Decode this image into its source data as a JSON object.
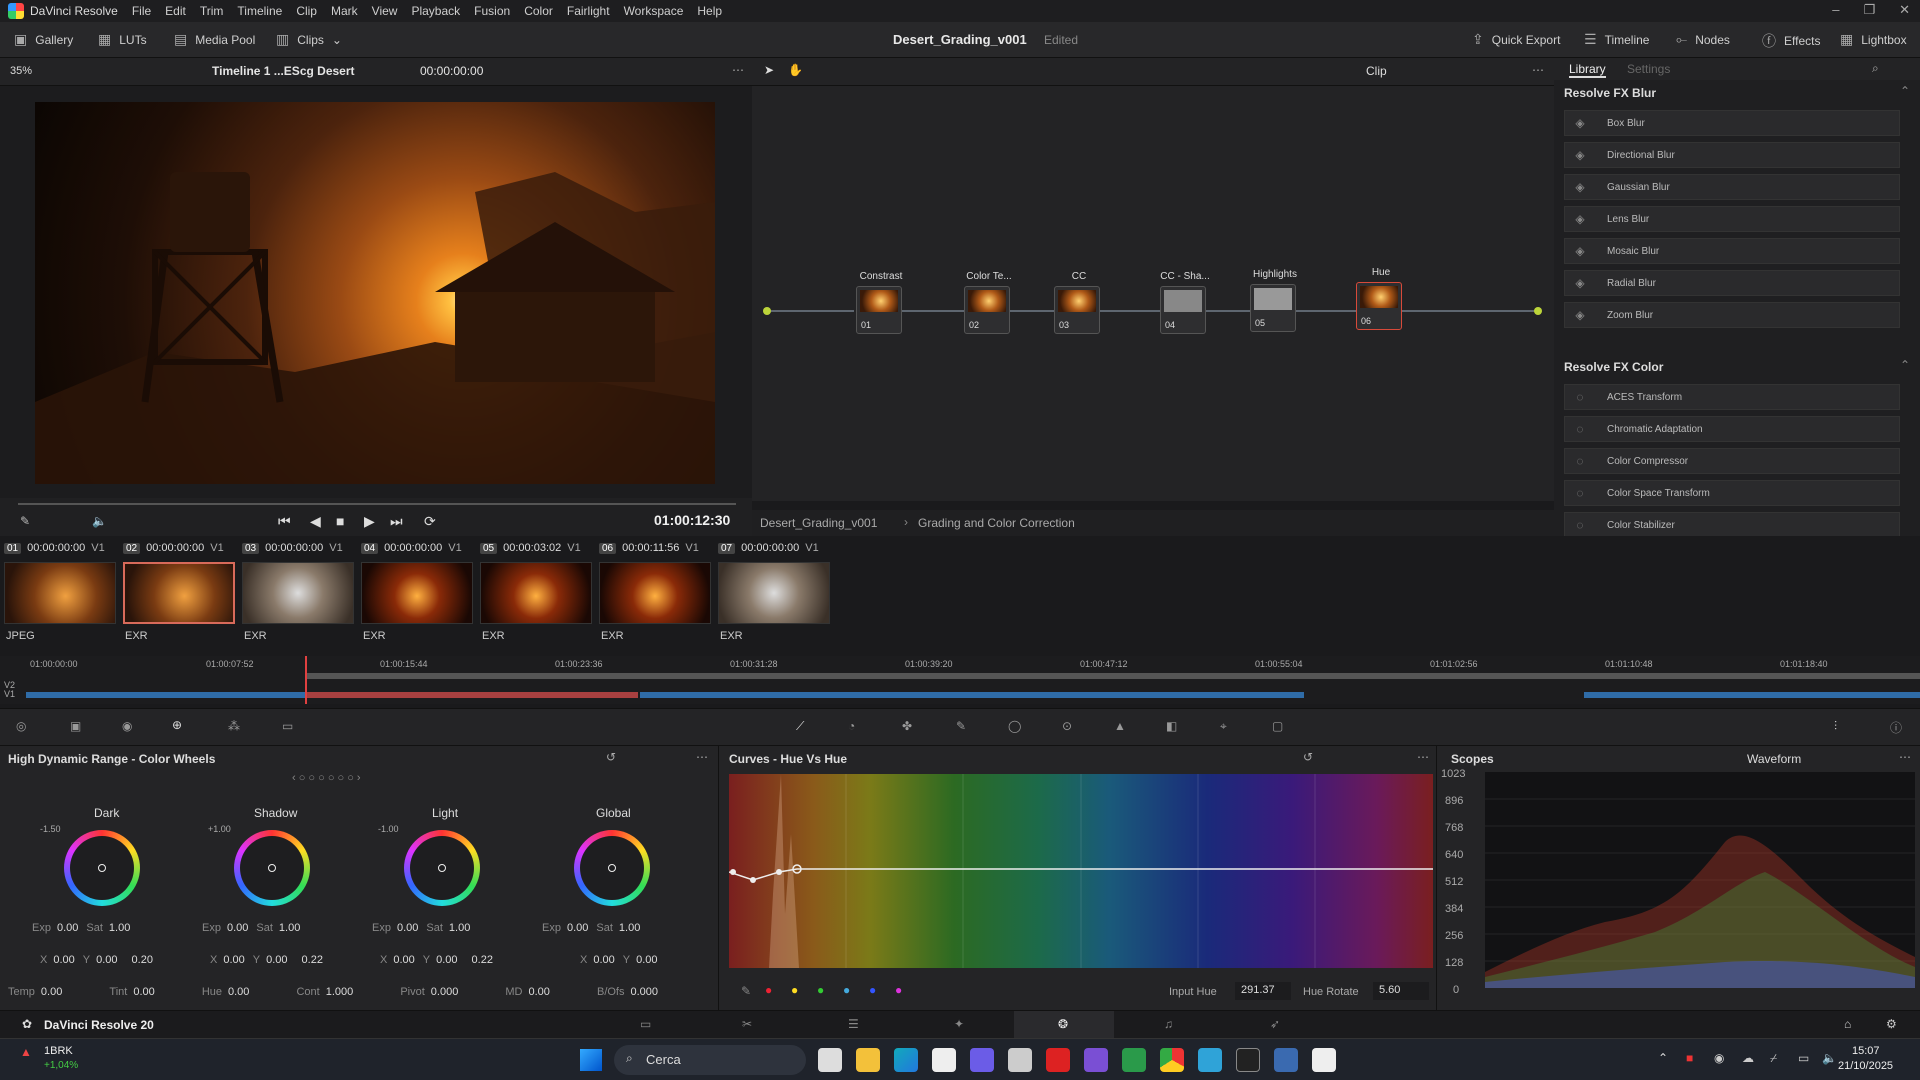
{
  "app": {
    "name": "DaVinci Resolve",
    "menu": [
      "File",
      "Edit",
      "Trim",
      "Timeline",
      "Clip",
      "Mark",
      "View",
      "Playback",
      "Fusion",
      "Color",
      "Fairlight",
      "Workspace",
      "Help"
    ],
    "version_label": "DaVinci Resolve 20"
  },
  "toolbar": {
    "gallery": "Gallery",
    "luts": "LUTs",
    "media_pool": "Media Pool",
    "clips": "Clips",
    "project_title": "Desert_Grading_v001",
    "project_state": "Edited",
    "quick_export": "Quick Export",
    "timeline": "Timeline",
    "nodes": "Nodes",
    "effects": "Effects",
    "lightbox": "Lightbox"
  },
  "viewer": {
    "zoom": "35%",
    "timeline_name": "Timeline 1 ...EScg Desert",
    "timecode_top": "00:00:00:00",
    "timecode": "01:00:12:30",
    "clip_mode": "Clip"
  },
  "nodes": [
    {
      "label": "Constrast",
      "num": "01"
    },
    {
      "label": "Color Te...",
      "num": "02"
    },
    {
      "label": "CC",
      "num": "03"
    },
    {
      "label": "CC - Sha...",
      "num": "04"
    },
    {
      "label": "Highlights",
      "num": "05"
    },
    {
      "label": "Hue",
      "num": "06"
    }
  ],
  "breadcrumb": [
    "Desert_Grading_v001",
    "Grading and Color Correction"
  ],
  "library": {
    "tabs": [
      "Library",
      "Settings"
    ],
    "sections": [
      {
        "title": "Resolve FX Blur",
        "items": [
          "Box Blur",
          "Directional Blur",
          "Gaussian Blur",
          "Lens Blur",
          "Mosaic Blur",
          "Radial Blur",
          "Zoom Blur"
        ]
      },
      {
        "title": "Resolve FX Color",
        "items": [
          "ACES Transform",
          "Chromatic Adaptation",
          "Color Compressor",
          "Color Space Transform",
          "Color Stabilizer"
        ]
      }
    ]
  },
  "clips": [
    {
      "num": "01",
      "tc": "00:00:00:00",
      "track": "V1",
      "type": "JPEG"
    },
    {
      "num": "02",
      "tc": "00:00:00:00",
      "track": "V1",
      "type": "EXR"
    },
    {
      "num": "03",
      "tc": "00:00:00:00",
      "track": "V1",
      "type": "EXR"
    },
    {
      "num": "04",
      "tc": "00:00:00:00",
      "track": "V1",
      "type": "EXR"
    },
    {
      "num": "05",
      "tc": "00:00:03:02",
      "track": "V1",
      "type": "EXR"
    },
    {
      "num": "06",
      "tc": "00:00:11:56",
      "track": "V1",
      "type": "EXR"
    },
    {
      "num": "07",
      "tc": "00:00:00:00",
      "track": "V1",
      "type": "EXR"
    }
  ],
  "timeline_ruler": [
    "01:00:00:00",
    "01:00:07:52",
    "01:00:15:44",
    "01:00:23:36",
    "01:00:31:28",
    "01:00:39:20",
    "01:00:47:12",
    "01:00:55:04",
    "01:01:02:56",
    "01:01:10:48",
    "01:01:18:40"
  ],
  "tracks": [
    "V2",
    "V1"
  ],
  "wheels_panel": {
    "title": "High Dynamic Range - Color Wheels",
    "wheels": [
      {
        "name": "Dark",
        "zone": "-1.50",
        "exp": "0.00",
        "sat": "1.00",
        "x": "0.00",
        "y": "0.00",
        "z": "0.20"
      },
      {
        "name": "Shadow",
        "zone": "+1.00",
        "exp": "0.00",
        "sat": "1.00",
        "x": "0.00",
        "y": "0.00",
        "z": "0.22"
      },
      {
        "name": "Light",
        "zone": "-1.00",
        "exp": "0.00",
        "sat": "1.00",
        "x": "0.00",
        "y": "0.00",
        "z": "0.22"
      },
      {
        "name": "Global",
        "zone": "",
        "exp": "0.00",
        "sat": "1.00",
        "x": "0.00",
        "y": "0.00",
        "z": ""
      }
    ],
    "labels": {
      "exp": "Exp",
      "sat": "Sat",
      "x": "X",
      "y": "Y"
    },
    "bottom": {
      "temp": "0.00",
      "tint": "0.00",
      "hue": "0.00",
      "cont": "1.000",
      "pivot": "0.000",
      "md": "0.00",
      "bofs": "0.000"
    },
    "bottom_labels": {
      "temp": "Temp",
      "tint": "Tint",
      "hue": "Hue",
      "cont": "Cont",
      "pivot": "Pivot",
      "md": "MD",
      "bofs": "B/Ofs"
    }
  },
  "curves_panel": {
    "title": "Curves - Hue Vs Hue",
    "input_hue_label": "Input Hue",
    "input_hue": "291.37",
    "hue_rotate_label": "Hue Rotate",
    "hue_rotate": "5.60"
  },
  "scopes_panel": {
    "title": "Scopes",
    "mode": "Waveform",
    "scale": [
      "1023",
      "896",
      "768",
      "640",
      "512",
      "384",
      "256",
      "128",
      "0"
    ]
  },
  "taskbar": {
    "search": "Cerca",
    "ticker": "1BRK",
    "ticker_change": "+1,04%",
    "time": "15:07",
    "date": "21/10/2025"
  }
}
